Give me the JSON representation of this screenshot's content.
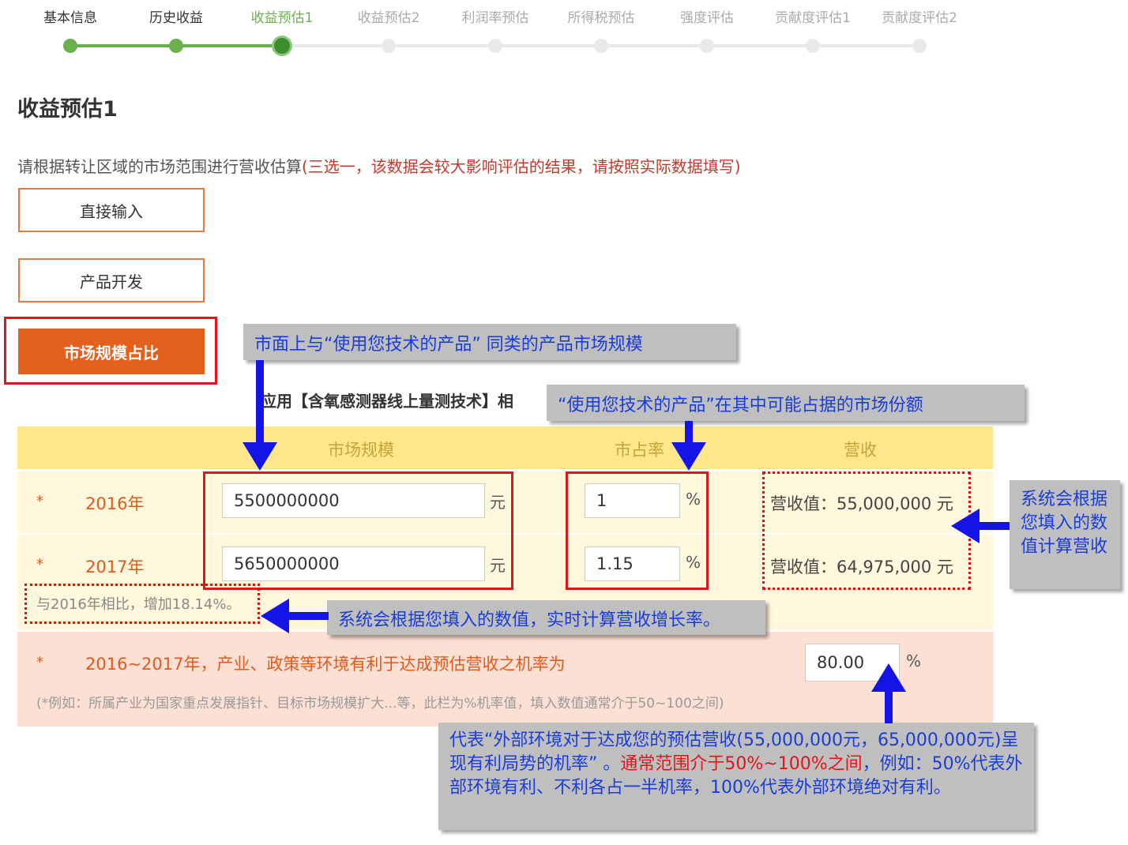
{
  "steps": [
    {
      "label": "基本信息",
      "state": "done"
    },
    {
      "label": "历史收益",
      "state": "done"
    },
    {
      "label": "收益预估1",
      "state": "active"
    },
    {
      "label": "收益预估2",
      "state": "todo"
    },
    {
      "label": "利润率预估",
      "state": "todo"
    },
    {
      "label": "所得税预估",
      "state": "todo"
    },
    {
      "label": "强度评估",
      "state": "todo"
    },
    {
      "label": "贡献度评估1",
      "state": "todo"
    },
    {
      "label": "贡献度评估2",
      "state": "todo"
    }
  ],
  "page_title": "收益预估1",
  "instruction": {
    "main": "请根据转让区域的市场范围进行营收估算",
    "note": "(三选一，该数据会较大影响评估的结果，请按照实际数据填写)"
  },
  "options": {
    "direct": "直接输入",
    "product": "产品开发",
    "market": "市场规模占比"
  },
  "section_subtitle": "应用【含氧感测器线上量测技术】相",
  "table": {
    "headers": {
      "market": "市场规模",
      "share": "市占率",
      "revenue": "营收"
    },
    "rows": [
      {
        "star": "*",
        "year": "2016年",
        "market": "5500000000",
        "market_unit": "元",
        "share": "1",
        "share_unit": "%",
        "revenue": "营收值：55,000,000 元"
      },
      {
        "star": "*",
        "year": "2017年",
        "market": "5650000000",
        "market_unit": "元",
        "share": "1.15",
        "share_unit": "%",
        "revenue": "营收值：64,975,000 元"
      }
    ],
    "growth": "与2016年相比，增加18.14%。"
  },
  "environment": {
    "star": "*",
    "label": "2016~2017年，产业、政策等环境有利于达成预估营收之机率为",
    "value": "80.00",
    "unit": "%",
    "note": "(*例如：所属产业为国家重点发展指针、目标市场规模扩大...等，此栏为%机率值，填入数值通常介于50~100之间)"
  },
  "callouts": {
    "market_size": "市面上与“使用您技术的产品” 同类的产品市场规模",
    "market_share": "“使用您技术的产品”在其中可能占据的市场份额",
    "revenue_calc": "系统会根据您填入的数值计算营收",
    "growth_calc": "系统会根据您填入的数值，实时计算营收增长率。",
    "env_blue1": "代表“外部环境对于达成您的预估营收(55,000,000元，65,000,000元)呈现有利局势的机率” 。",
    "env_red": "通常范围介于50%~100%之间",
    "env_blue2": "，例如：50%代表外部环境有利、不利各占一半机率，100%代表外部环境绝对有利。"
  },
  "colors": {
    "accent": "#e4601d",
    "progress": "#6ab04c",
    "callout_text": "#1a3dd8",
    "annotation_red": "#e4141b"
  }
}
